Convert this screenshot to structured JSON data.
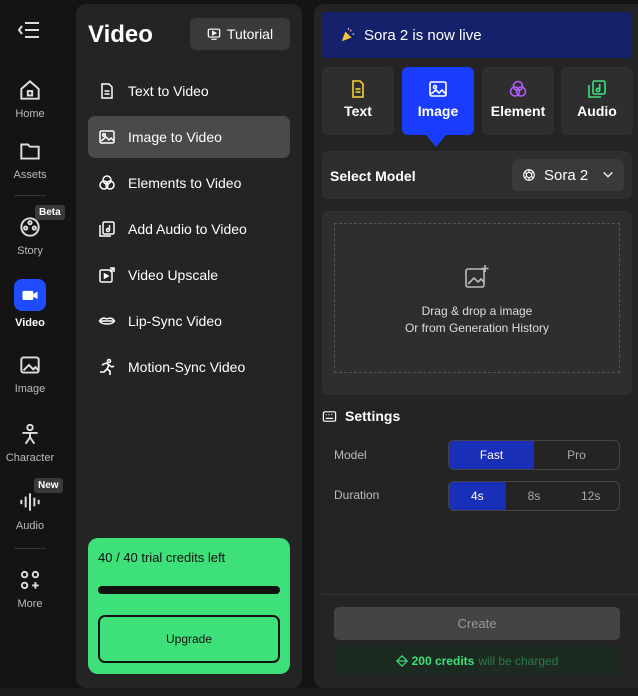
{
  "rail": {
    "items": [
      {
        "label": "Home",
        "icon": "home-icon"
      },
      {
        "label": "Assets",
        "icon": "folder-icon"
      },
      {
        "label": "Story",
        "icon": "film-reel-icon",
        "badge": "Beta"
      },
      {
        "label": "Video",
        "icon": "video-camera-icon",
        "active": true
      },
      {
        "label": "Image",
        "icon": "image-icon"
      },
      {
        "label": "Character",
        "icon": "character-icon"
      },
      {
        "label": "Audio",
        "icon": "waveform-icon",
        "badge": "New"
      },
      {
        "label": "More",
        "icon": "grid-icon"
      }
    ]
  },
  "mid": {
    "title": "Video",
    "tutorial_label": "Tutorial",
    "menu": [
      {
        "label": "Text to Video"
      },
      {
        "label": "Image to Video",
        "active": true
      },
      {
        "label": "Elements to Video"
      },
      {
        "label": "Add Audio to Video"
      },
      {
        "label": "Video Upscale"
      },
      {
        "label": "Lip-Sync Video"
      },
      {
        "label": "Motion-Sync Video"
      }
    ],
    "credits": {
      "text": "40 / 40 trial credits left",
      "remaining_fraction": 1.0,
      "upgrade_label": "Upgrade"
    }
  },
  "right": {
    "banner": "Sora 2 is now live",
    "tabs": [
      {
        "label": "Text"
      },
      {
        "label": "Image",
        "active": true
      },
      {
        "label": "Element"
      },
      {
        "label": "Audio"
      }
    ],
    "model_label": "Select Model",
    "model_value": "Sora 2",
    "drop_line1": "Drag & drop a image",
    "drop_line2": "Or from Generation History",
    "settings_title": "Settings",
    "model_row_label": "Model",
    "model_options": [
      "Fast",
      "Pro"
    ],
    "model_selected": "Fast",
    "duration_label": "Duration",
    "duration_options": [
      "4s",
      "8s",
      "12s"
    ],
    "duration_selected": "4s",
    "create_label": "Create",
    "charge_amount": "200 credits",
    "charge_suffix": "will be charged"
  },
  "colors": {
    "accent": "#1a3cff",
    "credits_green": "#3ee07a",
    "banner": "#15216a"
  }
}
